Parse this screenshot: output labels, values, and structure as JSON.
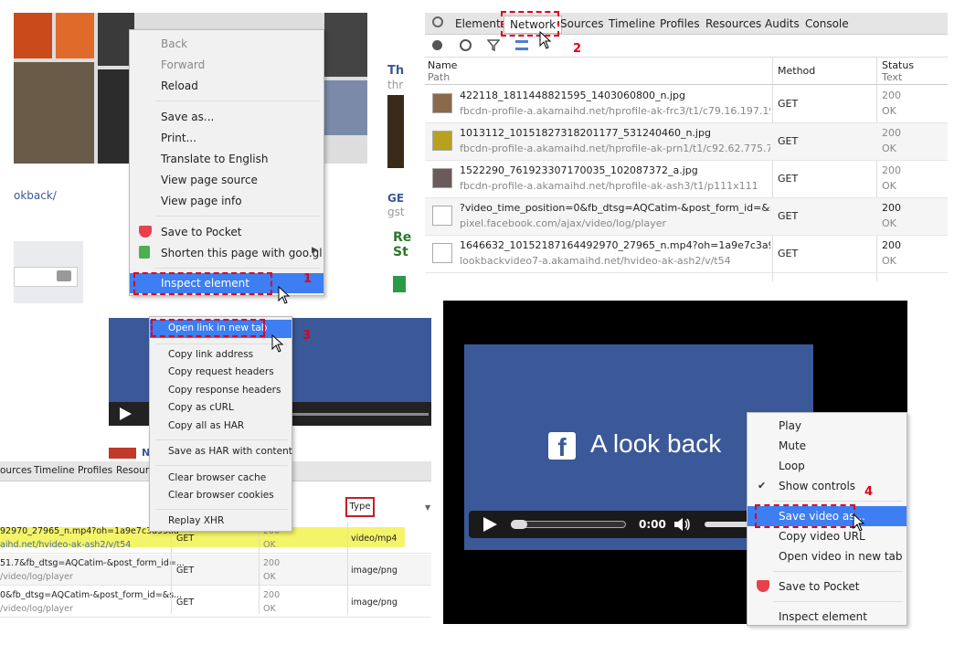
{
  "panel1": {
    "left_text": "okback/",
    "right_title": "Th",
    "right_sub": "thr",
    "right_get": "GE",
    "right_gst": "gst",
    "right_re": "Re",
    "right_st": "St",
    "menu": [
      "Back",
      "Forward",
      "Reload",
      "Save as...",
      "Print...",
      "Translate to English",
      "View page source",
      "View page info",
      "Save to Pocket",
      "Shorten this page with goo.gl",
      "Inspect element"
    ],
    "step": "1"
  },
  "panel2": {
    "tabs": [
      "Elements",
      "Network",
      "Sources",
      "Timeline",
      "Profiles",
      "Resources",
      "Audits",
      "Console"
    ],
    "step": "2",
    "headers": {
      "name": "Name",
      "path": "Path",
      "method": "Method",
      "status": "Status",
      "text": "Text"
    },
    "rows": [
      {
        "name": "422118_1811448821595_1403060800_n.jpg",
        "path": "fbcdn-profile-a.akamaihd.net/hprofile-ak-frc3/t1/c79.16.197.197/s",
        "method": "GET",
        "status": "200",
        "text": "OK"
      },
      {
        "name": "1013112_10151827318201177_531240460_n.jpg",
        "path": "fbcdn-profile-a.akamaihd.net/hprofile-ak-prn1/t1/c92.62.775.775/s",
        "method": "GET",
        "status": "200",
        "text": "OK"
      },
      {
        "name": "1522290_761923307170035_102087372_a.jpg",
        "path": "fbcdn-profile-a.akamaihd.net/hprofile-ak-ash3/t1/p111x111",
        "method": "GET",
        "status": "200",
        "text": "OK"
      },
      {
        "name": "?video_time_position=0&fb_dtsg=AQCatim-&post_form_id=&s...",
        "path": "pixel.facebook.com/ajax/video/log/player",
        "method": "GET",
        "status": "200",
        "text": "OK"
      },
      {
        "name": "1646632_10152187164492970_27965_n.mp4?oh=1a9e7c3a95aad...",
        "path": "lookbackvideo7-a.akamaihd.net/hvideo-ak-ash2/v/t54",
        "method": "GET",
        "status": "200",
        "text": "OK"
      }
    ]
  },
  "panel3": {
    "step": "3",
    "menu": [
      "Open link in new tab",
      "Copy link address",
      "Copy request headers",
      "Copy response headers",
      "Copy as cURL",
      "Copy all as HAR",
      "Save as HAR with content",
      "Clear browser cache",
      "Clear browser cookies",
      "Replay XHR"
    ],
    "tabs": [
      "ources",
      "Timeline",
      "Profiles",
      "Resource"
    ],
    "type_header": "Type",
    "nn": "N",
    "rows": [
      {
        "name": "92970_27965_n.mp4?oh=1a9e7c3a95aa",
        "path": "aihd.net/hvideo-ak-ash2/v/t54",
        "method": "GET",
        "status": "200",
        "text": "OK",
        "type": "video/mp4"
      },
      {
        "name": "51.7&fb_dtsg=AQCatim-&post_form_id=...",
        "path": "/video/log/player",
        "method": "GET",
        "status": "200",
        "text": "OK",
        "type": "image/png"
      },
      {
        "name": "0&fb_dtsg=AQCatim-&post_form_id=&s...",
        "path": "/video/log/player",
        "method": "GET",
        "status": "200",
        "text": "OK",
        "type": "image/png"
      }
    ]
  },
  "panel4": {
    "title": "A look back",
    "time": "0:00",
    "step": "4",
    "menu": [
      "Play",
      "Mute",
      "Loop",
      "Show controls",
      "Save video as...",
      "Copy video URL",
      "Open video in new tab",
      "Save to Pocket",
      "Inspect element"
    ]
  }
}
